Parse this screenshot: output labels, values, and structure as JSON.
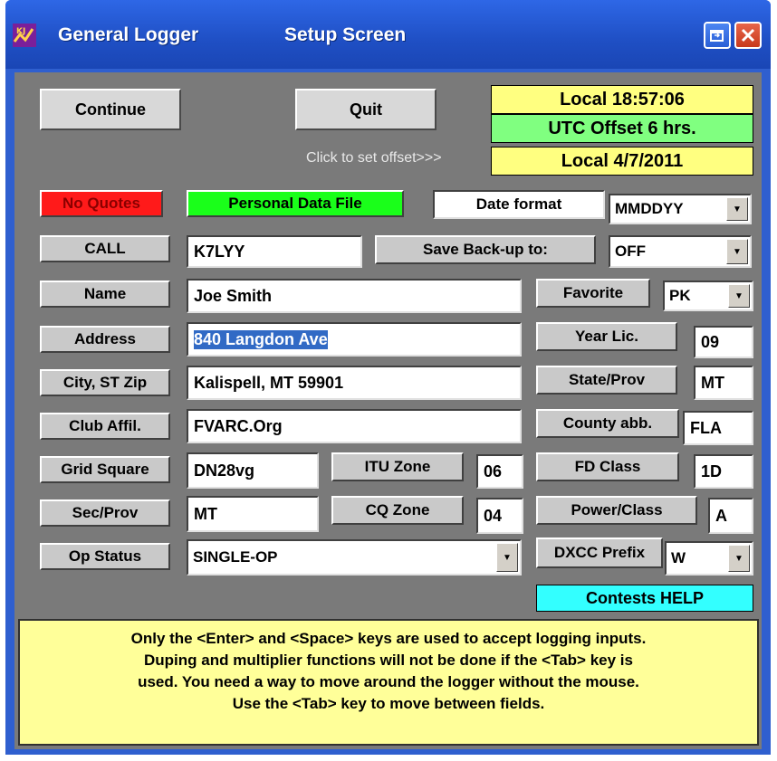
{
  "window": {
    "title_app": "General Logger",
    "title_screen": "Setup Screen",
    "icon_text": "KJ"
  },
  "toolbar": {
    "continue_label": "Continue",
    "quit_label": "Quit",
    "offset_hint": "Click to set offset>>>"
  },
  "clock": {
    "local_time": "Local 18:57:06",
    "utc_offset": "UTC Offset 6 hrs.",
    "local_date": "Local 4/7/2011"
  },
  "status": {
    "no_quotes": "No Quotes",
    "personal_data_file": "Personal Data File",
    "date_format_label": "Date format",
    "date_format_value": "MMDDYY"
  },
  "fields": {
    "call_label": "CALL",
    "call_value": "K7LYY",
    "backup_label": "Save Back-up to:",
    "backup_value": "OFF",
    "name_label": "Name",
    "name_value": "Joe Smith",
    "favorite_label": "Favorite",
    "favorite_value": "PK",
    "address_label": "Address",
    "address_value": "840 Langdon Ave",
    "year_lic_label": "Year Lic.",
    "year_lic_value": "09",
    "city_label": "City, ST Zip",
    "city_value": "Kalispell, MT 59901",
    "state_label": "State/Prov",
    "state_value": "MT",
    "club_label": "Club Affil.",
    "club_value": "FVARC.Org",
    "county_label": "County abb.",
    "county_value": "FLA",
    "grid_label": "Grid Square",
    "grid_value": "DN28vg",
    "itu_label": "ITU Zone",
    "itu_value": "06",
    "fd_label": "FD Class",
    "fd_value": "1D",
    "sec_label": "Sec/Prov",
    "sec_value": "MT",
    "cq_label": "CQ Zone",
    "cq_value": "04",
    "power_label": "Power/Class",
    "power_value": "A",
    "opstatus_label": "Op Status",
    "opstatus_value": "SINGLE-OP",
    "dxcc_label": "DXCC Prefix",
    "dxcc_value": "W"
  },
  "contests_help": "Contests HELP",
  "help_lines": [
    "Only the <Enter> and <Space> keys are used to accept logging inputs.",
    "Duping and multiplier functions will not be done if the <Tab> key is",
    "used. You need a way to move around the logger without the mouse.",
    "Use the <Tab> key to move between fields."
  ],
  "colors": {
    "title_bar": "#1f4fc4",
    "client_bg": "#7a7a7a",
    "clock_yellow": "#ffff80",
    "utc_green": "#80ff80",
    "no_quotes_red": "#ff1a1a",
    "personal_green": "#1aff1a",
    "contests_cyan": "#33ffff",
    "help_yellow": "#ffff99"
  }
}
